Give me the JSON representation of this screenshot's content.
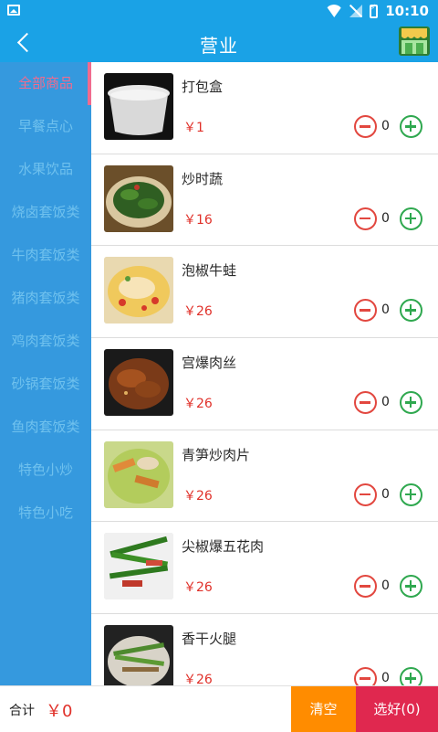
{
  "statusbar": {
    "time": "10:10"
  },
  "header": {
    "title": "营业"
  },
  "categories": [
    {
      "label": "全部商品",
      "active": true
    },
    {
      "label": "早餐点心"
    },
    {
      "label": "水果饮品"
    },
    {
      "label": "烧卤套饭类"
    },
    {
      "label": "牛肉套饭类"
    },
    {
      "label": "猪肉套饭类"
    },
    {
      "label": "鸡肉套饭类"
    },
    {
      "label": "砂锅套饭类"
    },
    {
      "label": "鱼肉套饭类"
    },
    {
      "label": "特色小炒"
    },
    {
      "label": "特色小吃"
    }
  ],
  "items": [
    {
      "name": "打包盒",
      "price": "￥1",
      "qty": "0"
    },
    {
      "name": "炒时蔬",
      "price": "￥16",
      "qty": "0"
    },
    {
      "name": "泡椒牛蛙",
      "price": "￥26",
      "qty": "0"
    },
    {
      "name": "宫爆肉丝",
      "price": "￥26",
      "qty": "0"
    },
    {
      "name": "青笋炒肉片",
      "price": "￥26",
      "qty": "0"
    },
    {
      "name": "尖椒爆五花肉",
      "price": "￥26",
      "qty": "0"
    },
    {
      "name": "香干火腿",
      "price": "￥26",
      "qty": "0"
    }
  ],
  "footer": {
    "label": "合计",
    "total": "￥0",
    "clear": "清空",
    "done": "选好(0)"
  },
  "colors": {
    "primary": "#1aa2e6",
    "accent": "#e0284f",
    "orange": "#ff8c00",
    "price": "#e0312a",
    "active_category": "#f06b8e"
  }
}
